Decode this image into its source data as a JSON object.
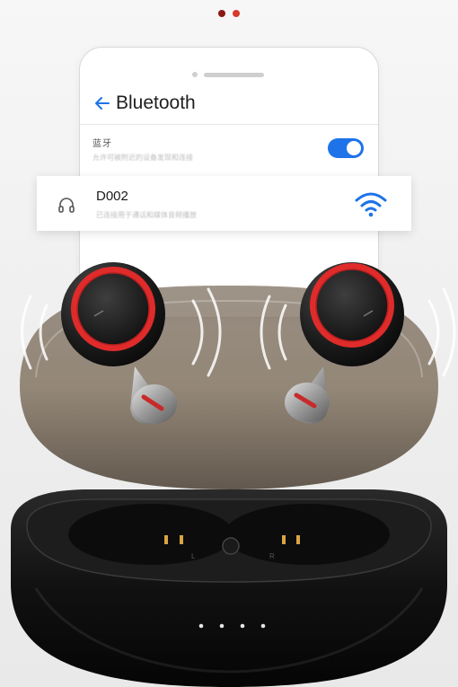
{
  "pagination": {
    "dots": [
      "#8a1a14",
      "#d63a2a"
    ]
  },
  "phone": {
    "header": {
      "title": "Bluetooth",
      "back_icon": "back-arrow-icon"
    },
    "setting_row": {
      "title": "蓝牙",
      "subtitle": "允许可被附近的设备发现和连接",
      "enabled": true
    }
  },
  "device_card": {
    "name": "D002",
    "subtitle": "已连接用于通话和媒体音频播放",
    "leading_icon": "headset-icon",
    "trailing_icon": "wifi-signal-icon"
  },
  "colors": {
    "accent_blue": "#1e73e8",
    "earbud_ring_red": "#e02b2b"
  },
  "case": {
    "slot_labels": [
      "L",
      "R"
    ],
    "led_count": 4
  }
}
